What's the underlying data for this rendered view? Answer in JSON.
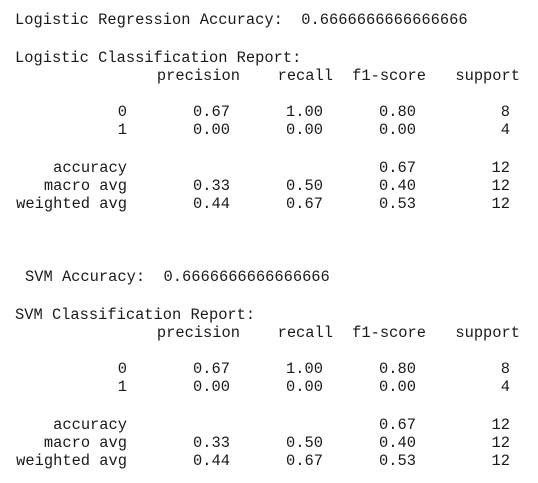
{
  "logistic": {
    "accuracy_line": "Logistic Regression Accuracy:  0.6666666666666666",
    "report_title": "Logistic Classification Report:",
    "headers": [
      "precision",
      "recall",
      "f1-score",
      "support"
    ],
    "rows": [
      {
        "label": "0",
        "precision": "0.67",
        "recall": "1.00",
        "f1": "0.80",
        "support": "8"
      },
      {
        "label": "1",
        "precision": "0.00",
        "recall": "0.00",
        "f1": "0.00",
        "support": "4"
      }
    ],
    "summary": [
      {
        "label": "accuracy",
        "precision": "",
        "recall": "",
        "f1": "0.67",
        "support": "12"
      },
      {
        "label": "macro avg",
        "precision": "0.33",
        "recall": "0.50",
        "f1": "0.40",
        "support": "12"
      },
      {
        "label": "weighted avg",
        "precision": "0.44",
        "recall": "0.67",
        "f1": "0.53",
        "support": "12"
      }
    ]
  },
  "svm": {
    "accuracy_line": "SVM Accuracy:  0.6666666666666666",
    "report_title": "SVM Classification Report:",
    "headers": [
      "precision",
      "recall",
      "f1-score",
      "support"
    ],
    "rows": [
      {
        "label": "0",
        "precision": "0.67",
        "recall": "1.00",
        "f1": "0.80",
        "support": "8"
      },
      {
        "label": "1",
        "precision": "0.00",
        "recall": "0.00",
        "f1": "0.00",
        "support": "4"
      }
    ],
    "summary": [
      {
        "label": "accuracy",
        "precision": "",
        "recall": "",
        "f1": "0.67",
        "support": "12"
      },
      {
        "label": "macro avg",
        "precision": "0.33",
        "recall": "0.50",
        "f1": "0.40",
        "support": "12"
      },
      {
        "label": "weighted avg",
        "precision": "0.44",
        "recall": "0.67",
        "f1": "0.53",
        "support": "12"
      }
    ]
  }
}
